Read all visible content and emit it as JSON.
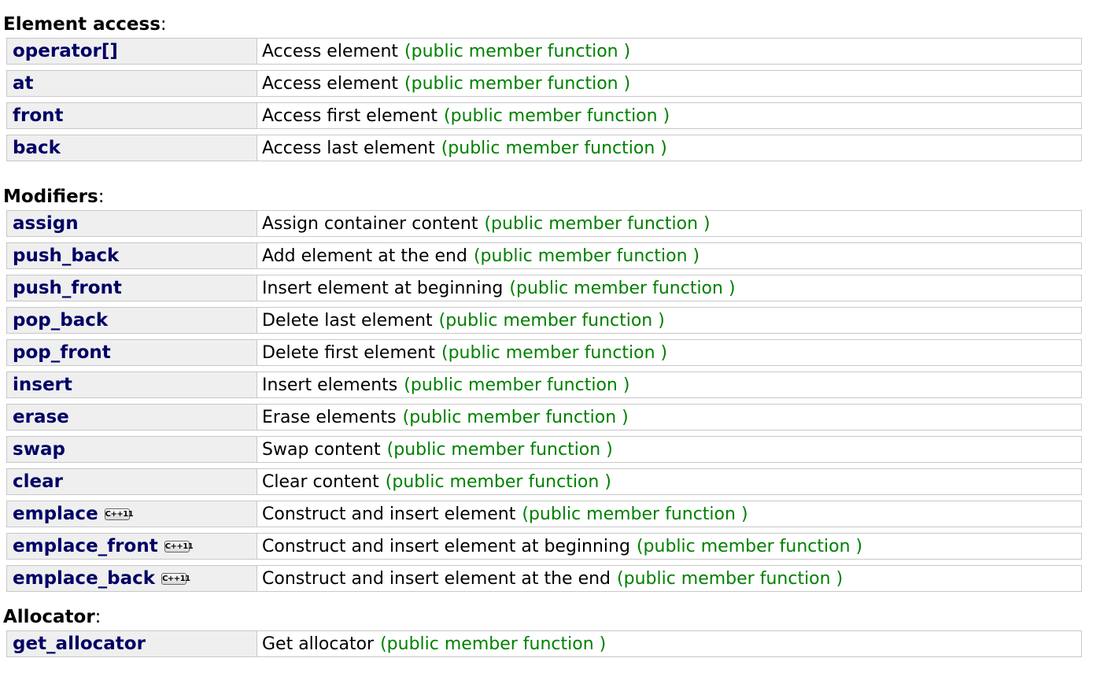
{
  "sections": [
    {
      "title": "Element access",
      "colon": ":",
      "rows": [
        {
          "name": "operator[]",
          "desc": "Access element",
          "type": "(public member function )"
        },
        {
          "name": "at",
          "desc": "Access element",
          "type": "(public member function )"
        },
        {
          "name": "front",
          "desc": "Access first element",
          "type": "(public member function )"
        },
        {
          "name": "back",
          "desc": "Access last element",
          "type": "(public member function )"
        }
      ]
    },
    {
      "title": "Modifiers",
      "colon": ":",
      "rows": [
        {
          "name": "assign",
          "desc": "Assign container content",
          "type": "(public member function )"
        },
        {
          "name": "push_back",
          "desc": "Add element at the end",
          "type": "(public member function )"
        },
        {
          "name": "push_front",
          "desc": "Insert element at beginning",
          "type": "(public member function )"
        },
        {
          "name": "pop_back",
          "desc": "Delete last element",
          "type": "(public member function )"
        },
        {
          "name": "pop_front",
          "desc": "Delete first element",
          "type": "(public member function )"
        },
        {
          "name": "insert",
          "desc": "Insert elements",
          "type": "(public member function )"
        },
        {
          "name": "erase",
          "desc": "Erase elements",
          "type": "(public member function )"
        },
        {
          "name": "swap",
          "desc": "Swap content",
          "type": "(public member function )"
        },
        {
          "name": "clear",
          "desc": "Clear content",
          "type": "(public member function )"
        },
        {
          "name": "emplace",
          "badge": "C++11",
          "desc": "Construct and insert element",
          "type": "(public member function )"
        },
        {
          "name": "emplace_front",
          "badge": "C++11",
          "desc": "Construct and insert element at beginning",
          "type": "(public member function )"
        },
        {
          "name": "emplace_back",
          "badge": "C++11",
          "desc": "Construct and insert element at the end",
          "type": "(public member function )"
        }
      ]
    },
    {
      "title": "Allocator",
      "colon": ":",
      "rows": [
        {
          "name": "get_allocator",
          "desc": "Get allocator",
          "type": "(public member function )"
        }
      ]
    }
  ],
  "colors": {
    "link": "#000066",
    "member_type": "#008000",
    "name_cell_bg": "#efefef",
    "border": "#c8c8c8"
  }
}
